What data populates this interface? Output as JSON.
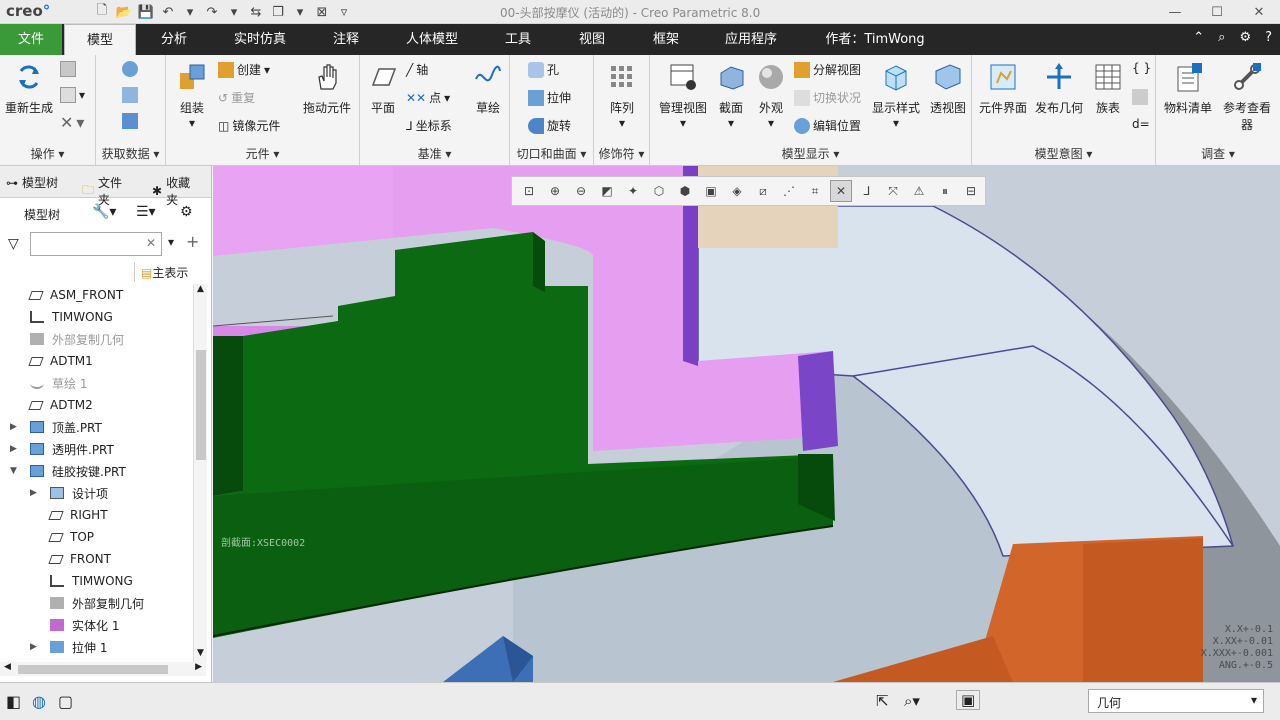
{
  "window": {
    "logo": "creo",
    "title": "00-头部按摩仪 (活动的) - Creo Parametric 8.0"
  },
  "tabs": [
    "文件",
    "模型",
    "分析",
    "实时仿真",
    "注释",
    "人体模型",
    "工具",
    "视图",
    "框架",
    "应用程序",
    "作者：TimWong"
  ],
  "ribbon": {
    "groups": {
      "operations": "操作",
      "get_data": "获取数据",
      "components": "元件",
      "datum": "基准",
      "cut_surface": "切口和曲面",
      "modifiers": "修饰符",
      "model_display": "模型显示",
      "model_intent": "模型意图",
      "investigate": "调查"
    },
    "buttons": {
      "regenerate": "重新生成",
      "assemble": "组装",
      "create": "创建",
      "repeat": "重复",
      "mirror_component": "镜像元件",
      "drag_components": "拖动元件",
      "plane": "平面",
      "axis": "轴",
      "point": "点",
      "coord_sys": "坐标系",
      "sketch": "草绘",
      "hole": "孔",
      "extrude": "拉伸",
      "revolve": "旋转",
      "pattern": "阵列",
      "manage_views": "管理视图",
      "section": "截面",
      "appearance": "外观",
      "exploded_view": "分解视图",
      "toggle_status": "切换状况",
      "edit_position": "编辑位置",
      "display_style": "显示样式",
      "perspective_view": "透视图",
      "component_interface": "元件界面",
      "publish_geometry": "发布几何",
      "family_table": "族表",
      "bill_of_materials": "物料清单",
      "reference_viewer": "参考查看器"
    }
  },
  "left_panel": {
    "tabs": [
      "模型树",
      "文件夹",
      "收藏夹"
    ],
    "tree_label": "模型树",
    "filter_placeholder": "",
    "main_representation": "主表示",
    "tree_items": [
      {
        "label": "ASM_FRONT",
        "indent": 0,
        "expander": "",
        "icon": "datum-plane-icon"
      },
      {
        "label": "TIMWONG",
        "indent": 0,
        "expander": "",
        "icon": "csys-icon"
      },
      {
        "label": "外部复制几何",
        "indent": 0,
        "expander": "",
        "icon": "copy-geometry-icon",
        "dim": true
      },
      {
        "label": "ADTM1",
        "indent": 0,
        "expander": "",
        "icon": "datum-plane-icon"
      },
      {
        "label": "草绘 1",
        "indent": 0,
        "expander": "",
        "icon": "sketch-icon",
        "dim": true
      },
      {
        "label": "ADTM2",
        "indent": 0,
        "expander": "",
        "icon": "datum-plane-icon"
      },
      {
        "label": "顶盖.PRT",
        "indent": 0,
        "expander": "▶",
        "icon": "part-icon"
      },
      {
        "label": "透明件.PRT",
        "indent": 0,
        "expander": "▶",
        "icon": "part-icon"
      },
      {
        "label": "硅胶按键.PRT",
        "indent": 0,
        "expander": "▼",
        "icon": "part-icon"
      },
      {
        "label": "设计项",
        "indent": 1,
        "expander": "▶",
        "icon": "design-items-icon"
      },
      {
        "label": "RIGHT",
        "indent": 1,
        "expander": "",
        "icon": "datum-plane-icon"
      },
      {
        "label": "TOP",
        "indent": 1,
        "expander": "",
        "icon": "datum-plane-icon"
      },
      {
        "label": "FRONT",
        "indent": 1,
        "expander": "",
        "icon": "datum-plane-icon"
      },
      {
        "label": "TIMWONG",
        "indent": 1,
        "expander": "",
        "icon": "csys-icon"
      },
      {
        "label": "外部复制几何",
        "indent": 1,
        "expander": "",
        "icon": "copy-geometry-icon"
      },
      {
        "label": "实体化 1",
        "indent": 1,
        "expander": "",
        "icon": "solidify-icon"
      },
      {
        "label": "拉伸 1",
        "indent": 1,
        "expander": "▶",
        "icon": "extrude-icon"
      }
    ]
  },
  "viewport": {
    "section_label": "剖截面:XSEC0002",
    "readout": [
      "X.X+-0.1",
      "X.XX+-0.01",
      "X.XXX+-0.001",
      "ANG.+-0.5"
    ]
  },
  "status_bar": {
    "selection_filter": "几何"
  }
}
